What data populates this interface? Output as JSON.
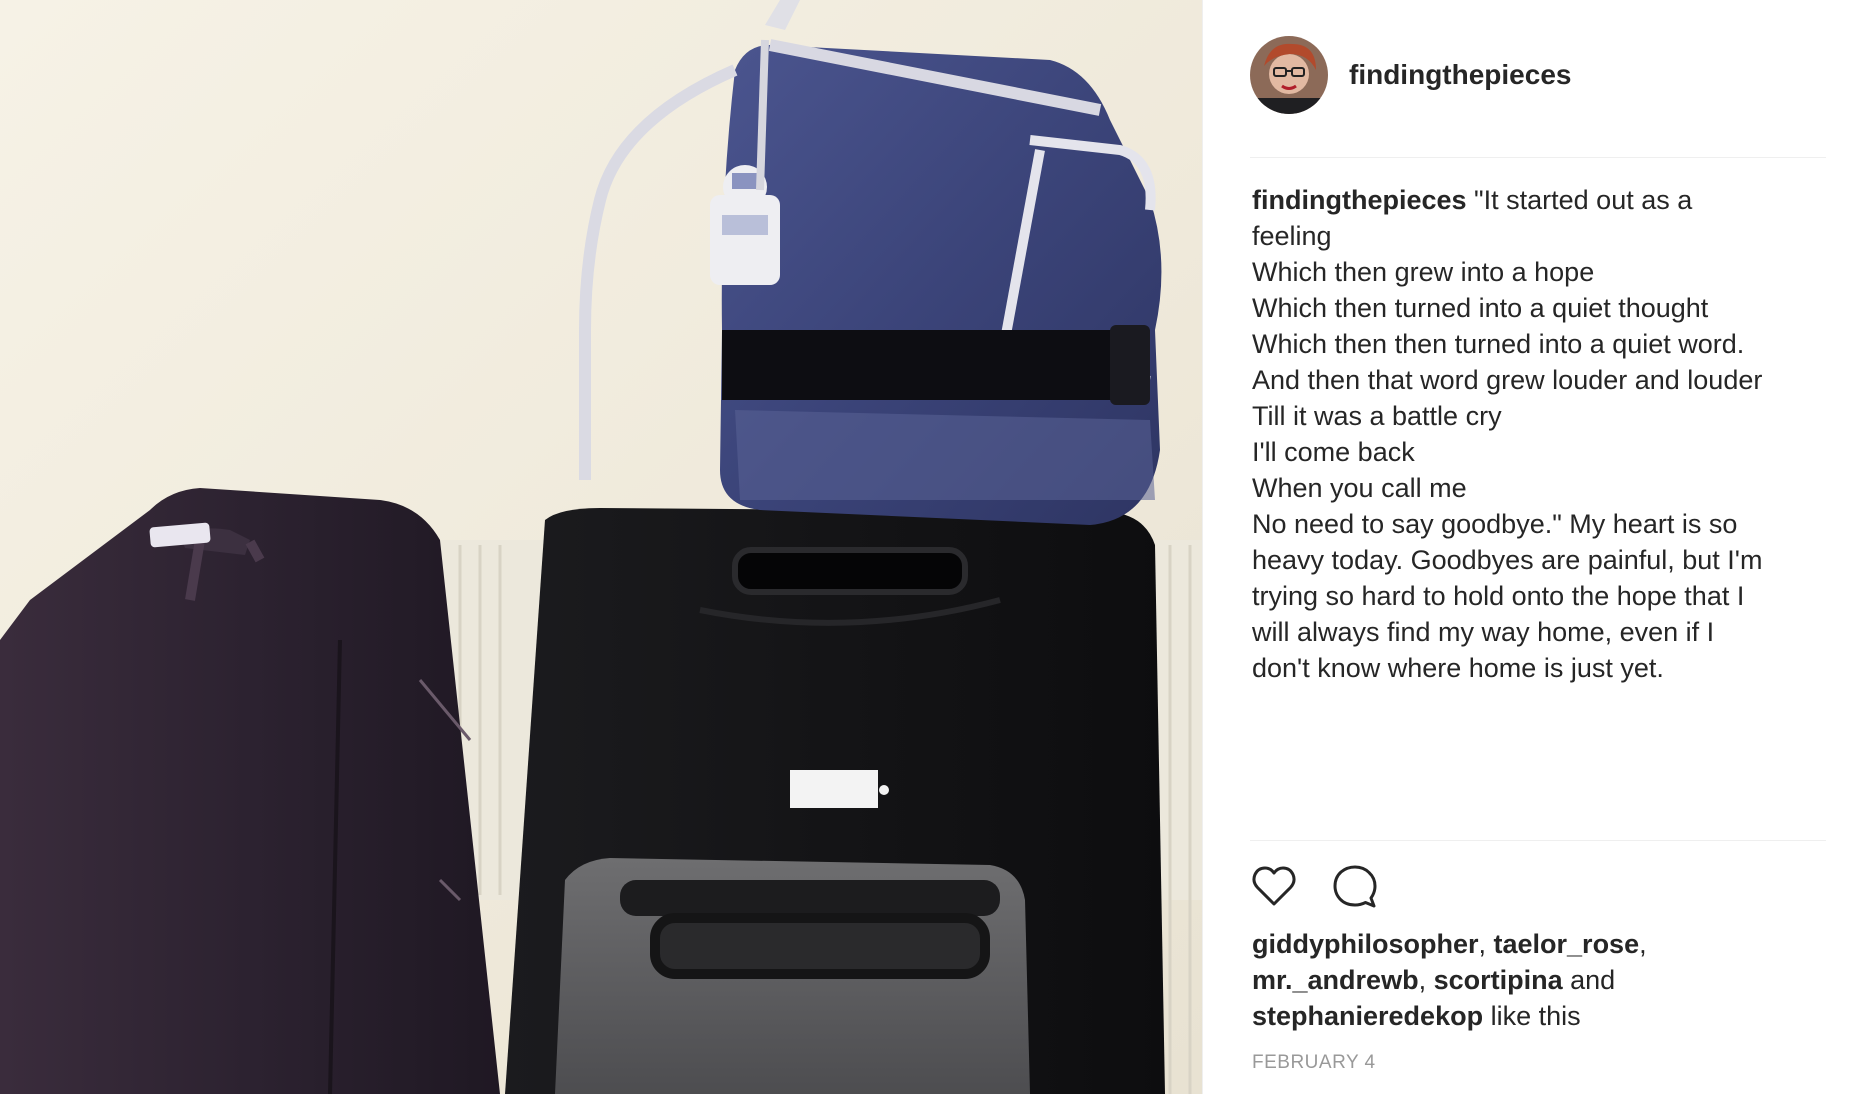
{
  "post": {
    "username": "findingthepieces",
    "caption_lines": [
      "\"It started out as a",
      "feeling",
      "Which then grew into a hope",
      "Which then turned into a quiet thought",
      "Which then then turned into a quiet word.",
      "And then that word grew louder and louder",
      "Till it was a battle cry",
      "I'll come back",
      "When you call me",
      "No need to say goodbye.\" My heart is so",
      "heavy today. Goodbyes are painful, but I'm",
      "trying so hard to hold onto the hope that I",
      "will always find my way home, even if I",
      "don't know where home is just yet."
    ],
    "likes": {
      "users": [
        "giddyphilosopher",
        "taelor_rose",
        "mr._andrewb",
        "scortipina",
        "stephanieredekop"
      ],
      "sep": ", ",
      "and_word": " and",
      "suffix": " like this"
    },
    "date": "FEBRUARY 4",
    "icons": {
      "like": "heart-icon",
      "comment": "comment-icon"
    }
  },
  "colors": {
    "text": "#262626",
    "muted": "#999999",
    "divider": "#efefef"
  }
}
